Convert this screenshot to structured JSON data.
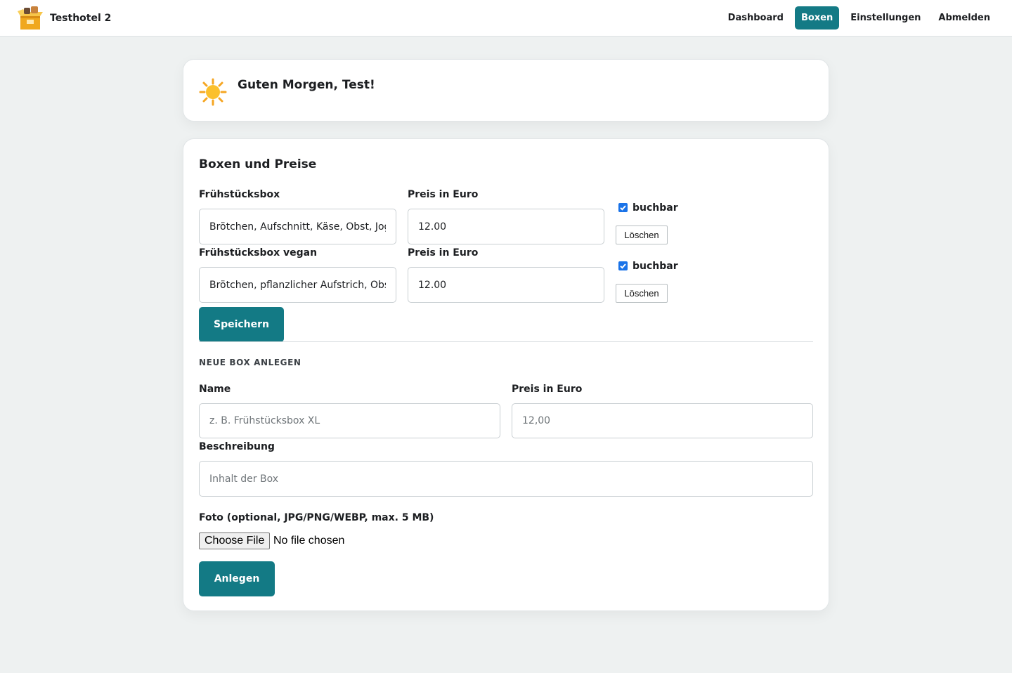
{
  "header": {
    "brand_name": "Testhotel 2",
    "logo_icon": "box-logo-icon",
    "nav": [
      {
        "label": "Dashboard",
        "active": false
      },
      {
        "label": "Boxen",
        "active": true
      },
      {
        "label": "Einstellungen",
        "active": false
      },
      {
        "label": "Abmelden",
        "active": false
      }
    ]
  },
  "greeting": {
    "icon": "sun-icon",
    "text": "Guten Morgen, Test!"
  },
  "boxes": {
    "title": "Boxen und Preise",
    "items": [
      {
        "name_label": "Frühstücksbox",
        "description_value": "Brötchen, Aufschnitt, Käse, Obst, Joghurt",
        "price_label": "Preis in Euro",
        "price_value": "12.00",
        "bookable_label": "buchbar",
        "bookable": true,
        "delete_label": "Löschen"
      },
      {
        "name_label": "Frühstücksbox vegan",
        "description_value": "Brötchen, pflanzlicher Aufstrich, Obst",
        "price_label": "Preis in Euro",
        "price_value": "12.00",
        "bookable_label": "buchbar",
        "bookable": true,
        "delete_label": "Löschen"
      }
    ],
    "save_label": "Speichern"
  },
  "new_box": {
    "heading": "NEUE BOX ANLEGEN",
    "name_label": "Name",
    "name_placeholder": "z. B. Frühstücksbox XL",
    "price_label": "Preis in Euro",
    "price_placeholder": "12,00",
    "description_label": "Beschreibung",
    "description_placeholder": "Inhalt der Box",
    "photo_label": "Foto (optional, JPG/PNG/WEBP, max. 5 MB)",
    "file_button_label": "Choose File",
    "file_status": "No file chosen",
    "submit_label": "Anlegen"
  },
  "colors": {
    "accent": "#137a85",
    "background": "#eef1f1",
    "checkbox": "#1a73e8"
  }
}
